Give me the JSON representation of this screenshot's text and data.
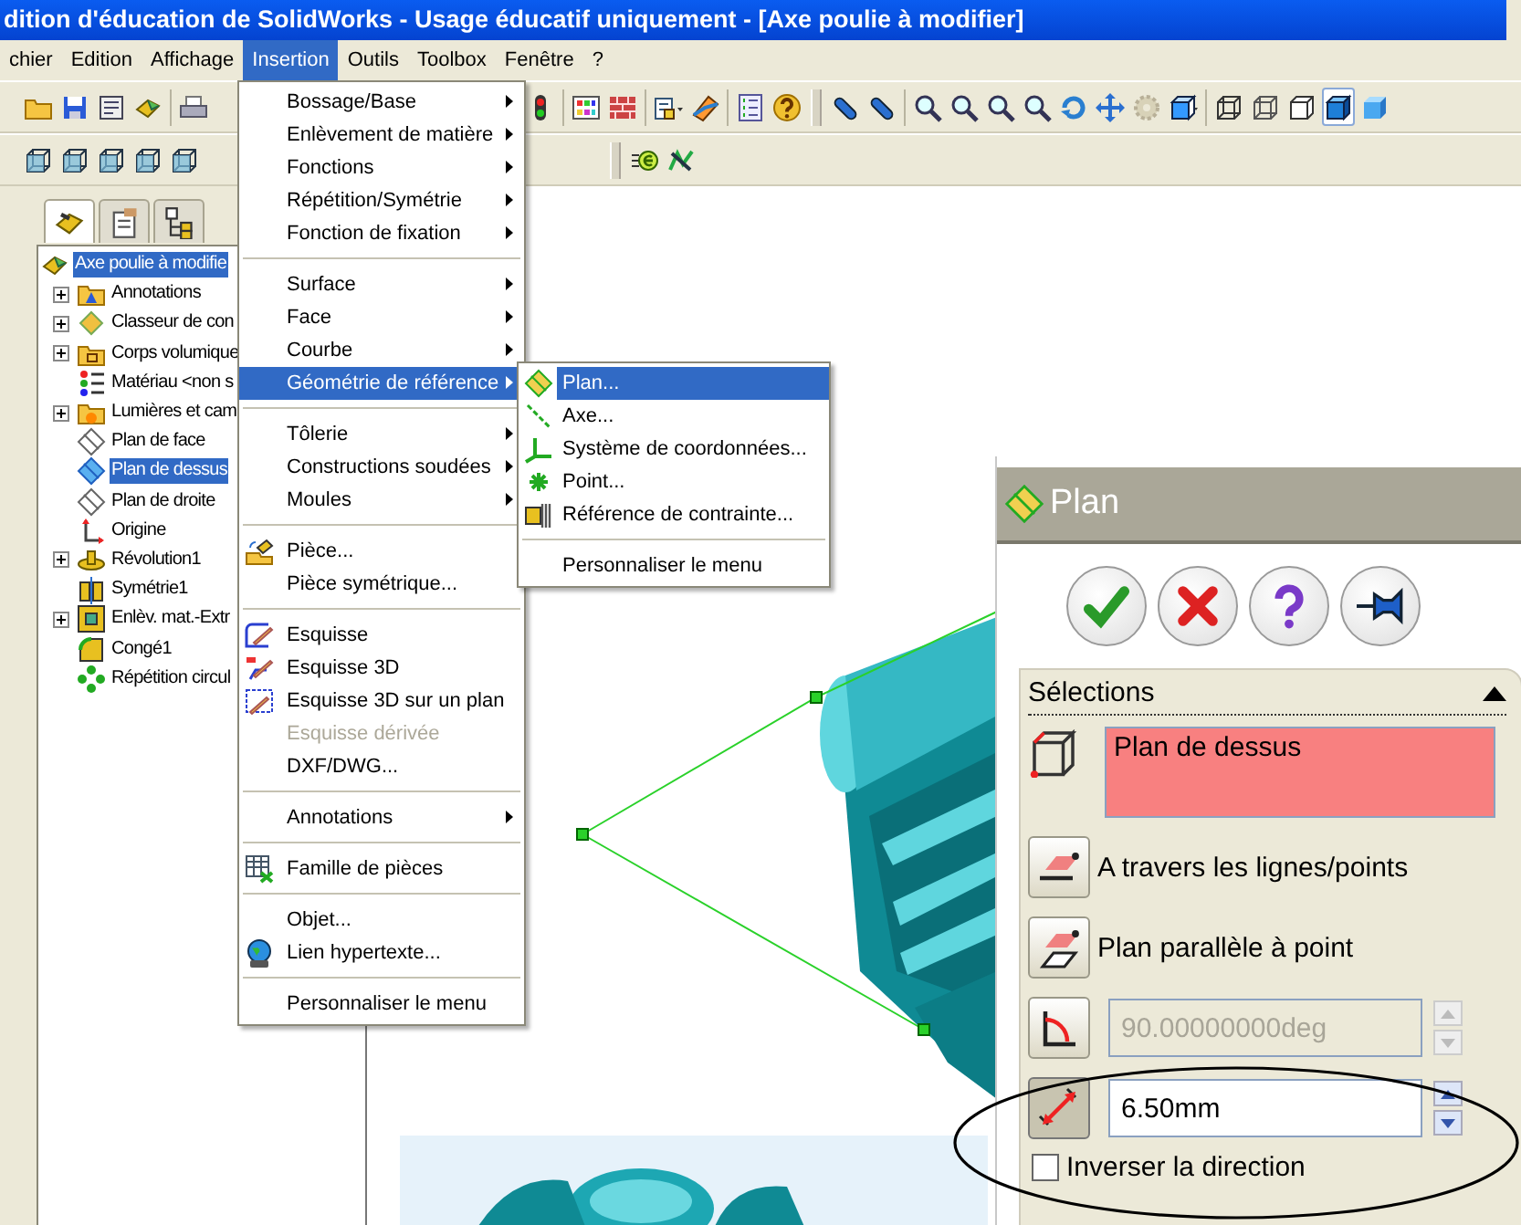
{
  "window": {
    "title": "dition d'éducation de SolidWorks - Usage éducatif uniquement - [Axe poulie à modifier]"
  },
  "menubar": [
    {
      "label": "chier",
      "selected": false
    },
    {
      "label": "Edition",
      "selected": false
    },
    {
      "label": "Affichage",
      "selected": false
    },
    {
      "label": "Insertion",
      "selected": true
    },
    {
      "label": "Outils",
      "selected": false
    },
    {
      "label": "Toolbox",
      "selected": false
    },
    {
      "label": "Fenêtre",
      "selected": false
    },
    {
      "label": "?",
      "selected": false
    }
  ],
  "toolbar_rows": [
    {
      "left": [
        {
          "kind": "open"
        },
        {
          "kind": "save"
        },
        {
          "kind": "props"
        },
        {
          "kind": "part"
        },
        {
          "kind": "sep"
        },
        {
          "kind": "print"
        }
      ],
      "right": [
        {
          "kind": "light"
        },
        {
          "kind": "sep"
        },
        {
          "kind": "colors"
        },
        {
          "kind": "texture"
        },
        {
          "kind": "sep"
        },
        {
          "kind": "measure"
        },
        {
          "kind": "section"
        },
        {
          "kind": "sep"
        },
        {
          "kind": "list"
        },
        {
          "kind": "help"
        },
        {
          "kind": "grip"
        },
        {
          "kind": "capsule"
        },
        {
          "kind": "capsule"
        },
        {
          "kind": "sep"
        },
        {
          "kind": "zoom"
        },
        {
          "kind": "zoom"
        },
        {
          "kind": "zoom"
        },
        {
          "kind": "zoom"
        },
        {
          "kind": "rotate"
        },
        {
          "kind": "pan"
        },
        {
          "kind": "gear"
        },
        {
          "kind": "viewcube"
        },
        {
          "kind": "sep"
        }
      ]
    },
    {
      "left": [
        {
          "kind": "cube"
        },
        {
          "kind": "cube"
        },
        {
          "kind": "cube"
        },
        {
          "kind": "cube"
        },
        {
          "kind": "cube"
        }
      ],
      "right": [
        {
          "kind": "grip"
        },
        {
          "kind": "equation"
        },
        {
          "kind": "rebuild"
        }
      ]
    }
  ],
  "display_modes": [
    {
      "kind": "wire",
      "selected": false
    },
    {
      "kind": "hidden",
      "selected": false
    },
    {
      "kind": "plain",
      "selected": false
    },
    {
      "kind": "shaded_edges",
      "selected": true
    },
    {
      "kind": "shaded",
      "selected": false
    }
  ],
  "tree": {
    "tabs": [
      {
        "kind": "features",
        "selected": true
      },
      {
        "kind": "properties",
        "selected": false
      },
      {
        "kind": "config",
        "selected": false
      }
    ],
    "root": {
      "label": "Axe poulie à modifie",
      "kind": "part",
      "selected": true,
      "children": [
        {
          "label": "Annotations",
          "kind": "annotations",
          "expandable": true,
          "selected": false
        },
        {
          "label": "Classeur de con",
          "kind": "sensor",
          "expandable": true,
          "selected": false
        },
        {
          "label": "Corps volumique",
          "kind": "bodies",
          "expandable": true,
          "selected": false
        },
        {
          "label": "Matériau <non s",
          "kind": "material",
          "expandable": false,
          "selected": false
        },
        {
          "label": "Lumières et cam",
          "kind": "lights",
          "expandable": true,
          "selected": false
        },
        {
          "label": "Plan de face",
          "kind": "plane",
          "expandable": false,
          "selected": false
        },
        {
          "label": "Plan de dessus",
          "kind": "plane",
          "expandable": false,
          "selected": true
        },
        {
          "label": "Plan de droite",
          "kind": "plane",
          "expandable": false,
          "selected": false
        },
        {
          "label": "Origine",
          "kind": "origin",
          "expandable": false,
          "selected": false
        },
        {
          "label": "Révolution1",
          "kind": "revolve",
          "expandable": true,
          "selected": false
        },
        {
          "label": "Symétrie1",
          "kind": "mirror",
          "expandable": false,
          "selected": false
        },
        {
          "label": "Enlèv. mat.-Extr",
          "kind": "cut",
          "expandable": true,
          "selected": false
        },
        {
          "label": "Congé1",
          "kind": "fillet",
          "expandable": false,
          "selected": false
        },
        {
          "label": "Répétition circul",
          "kind": "pattern",
          "expandable": false,
          "selected": false
        }
      ]
    }
  },
  "menu": {
    "items": [
      {
        "kind": "item",
        "label": "Bossage/Base",
        "submenu": true,
        "disabled": false,
        "selected": false
      },
      {
        "kind": "item",
        "label": "Enlèvement de matière",
        "submenu": true,
        "disabled": false,
        "selected": false
      },
      {
        "kind": "item",
        "label": "Fonctions",
        "submenu": true,
        "disabled": false,
        "selected": false
      },
      {
        "kind": "item",
        "label": "Répétition/Symétrie",
        "submenu": true,
        "disabled": false,
        "selected": false
      },
      {
        "kind": "item",
        "label": "Fonction de fixation",
        "submenu": true,
        "disabled": false,
        "selected": false
      },
      {
        "kind": "separator"
      },
      {
        "kind": "item",
        "label": "Surface",
        "submenu": true,
        "disabled": false,
        "selected": false
      },
      {
        "kind": "item",
        "label": "Face",
        "submenu": true,
        "disabled": false,
        "selected": false
      },
      {
        "kind": "item",
        "label": "Courbe",
        "submenu": true,
        "disabled": false,
        "selected": false
      },
      {
        "kind": "item",
        "label": "Géométrie de référence",
        "submenu": true,
        "disabled": false,
        "selected": true
      },
      {
        "kind": "separator"
      },
      {
        "kind": "item",
        "label": "Tôlerie",
        "submenu": true,
        "disabled": false,
        "selected": false
      },
      {
        "kind": "item",
        "label": "Constructions soudées",
        "submenu": true,
        "disabled": false,
        "selected": false
      },
      {
        "kind": "item",
        "label": "Moules",
        "submenu": true,
        "disabled": false,
        "selected": false
      },
      {
        "kind": "separator"
      },
      {
        "kind": "piece",
        "label": "Pièce...",
        "submenu": false,
        "disabled": false,
        "selected": false
      },
      {
        "kind": "item",
        "label": "Pièce symétrique...",
        "submenu": false,
        "disabled": false,
        "selected": false
      },
      {
        "kind": "separator"
      },
      {
        "kind": "sketch",
        "label": "Esquisse",
        "submenu": false,
        "disabled": false,
        "selected": false
      },
      {
        "kind": "sketch3d",
        "label": "Esquisse 3D",
        "submenu": false,
        "disabled": false,
        "selected": false
      },
      {
        "kind": "sketch3dplane",
        "label": "Esquisse 3D sur un plan",
        "submenu": false,
        "disabled": false,
        "selected": false
      },
      {
        "kind": "item",
        "label": "Esquisse dérivée",
        "submenu": false,
        "disabled": true,
        "selected": false
      },
      {
        "kind": "item",
        "label": "DXF/DWG...",
        "submenu": false,
        "disabled": false,
        "selected": false
      },
      {
        "kind": "separator"
      },
      {
        "kind": "item",
        "label": "Annotations",
        "submenu": true,
        "disabled": false,
        "selected": false
      },
      {
        "kind": "separator"
      },
      {
        "kind": "table",
        "label": "Famille de pièces",
        "submenu": false,
        "disabled": false,
        "selected": false
      },
      {
        "kind": "separator"
      },
      {
        "kind": "item",
        "label": "Objet...",
        "submenu": false,
        "disabled": false,
        "selected": false
      },
      {
        "kind": "globe",
        "label": "Lien hypertexte...",
        "submenu": false,
        "disabled": false,
        "selected": false
      },
      {
        "kind": "separator"
      },
      {
        "kind": "item",
        "label": "Personnaliser le menu",
        "submenu": false,
        "disabled": false,
        "selected": false
      }
    ]
  },
  "submenu": {
    "items": [
      {
        "kind": "plane_menu",
        "label": "Plan...",
        "selected": true
      },
      {
        "kind": "axis",
        "label": "Axe...",
        "selected": false
      },
      {
        "kind": "coord",
        "label": "Système de coordonnées...",
        "selected": false
      },
      {
        "kind": "point",
        "label": "Point...",
        "selected": false
      },
      {
        "kind": "mate",
        "label": "Référence de contrainte...",
        "selected": false
      },
      {
        "kind": "separator"
      },
      {
        "kind": "item",
        "label": "Personnaliser le menu",
        "selected": false
      }
    ]
  },
  "property_panel": {
    "title": "Plan",
    "buttons": [
      {
        "kind": "ok"
      },
      {
        "kind": "cancel"
      },
      {
        "kind": "help"
      },
      {
        "kind": "pin"
      }
    ],
    "section": {
      "title": "Sélections",
      "expanded": true,
      "selection": "Plan de dessus",
      "options": [
        {
          "kind": "through",
          "label": "A travers les lignes/points",
          "selected": false
        },
        {
          "kind": "parallel",
          "label": "Plan parallèle à point",
          "selected": false
        },
        {
          "kind": "angle",
          "value": "90.00000000deg",
          "disabled": true,
          "selected": false
        },
        {
          "kind": "distance",
          "value": "6.50mm",
          "disabled": false,
          "selected": true
        },
        {
          "kind": "checkbox",
          "label": "Inverser la direction",
          "checked": false
        }
      ]
    }
  }
}
